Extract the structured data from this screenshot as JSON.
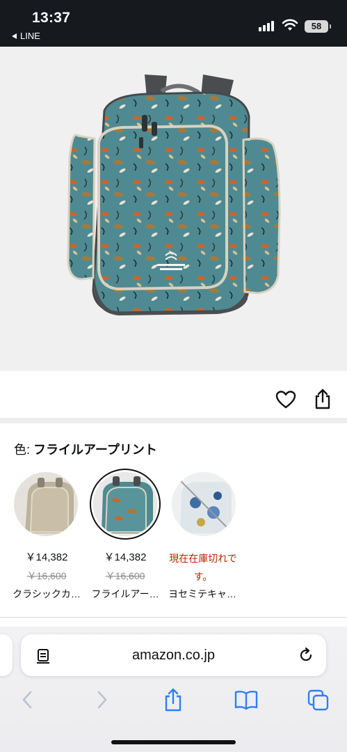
{
  "status_bar": {
    "time": "13:37",
    "back_app": "LINE",
    "battery": "58",
    "icons": [
      "signal-icon",
      "wifi-icon",
      "battery-icon"
    ]
  },
  "product": {
    "image_icon": "backpack-image",
    "actions": [
      "heart-icon",
      "share-icon"
    ]
  },
  "color_selector": {
    "label_key": "色: ",
    "label_value": "フライルアープリント",
    "options": [
      {
        "price": "￥14,382",
        "list_price": "￥16,600",
        "name": "クラシックカ…",
        "selected": false
      },
      {
        "price": "￥14,382",
        "list_price": "￥16,600",
        "name": "フライルアー…",
        "selected": true
      },
      {
        "status": "現在在庫切れです。",
        "name": "ヨセミテキャ…",
        "selected": false
      }
    ]
  },
  "browser": {
    "url": "amazon.co.jp",
    "toolbar": [
      "back-icon",
      "forward-icon",
      "share-icon",
      "bookmarks-icon",
      "tabs-icon"
    ]
  },
  "colors": {
    "status_bar_bg": "#16191e",
    "backpack_teal": "#4f8a92",
    "out_of_stock": "#b12704",
    "safari_blue": "#2f7ef6"
  }
}
